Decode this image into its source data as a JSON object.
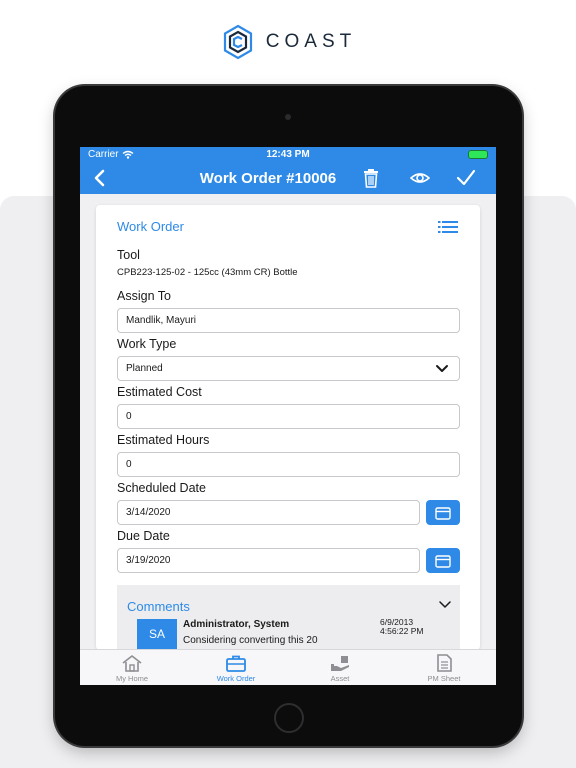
{
  "brand": {
    "name": "COAST"
  },
  "status_bar": {
    "carrier": "Carrier",
    "time": "12:43 PM"
  },
  "nav": {
    "title": "Work Order #10006"
  },
  "form": {
    "section_title": "Work Order",
    "tool": {
      "label": "Tool",
      "value": "CPB223-125-02 - 125cc (43mm CR) Bottle"
    },
    "assign_to": {
      "label": "Assign To",
      "value": "Mandlik, Mayuri"
    },
    "work_type": {
      "label": "Work Type",
      "value": "Planned"
    },
    "estimated_cost": {
      "label": "Estimated Cost",
      "value": "0"
    },
    "estimated_hours": {
      "label": "Estimated Hours",
      "value": "0"
    },
    "scheduled_date": {
      "label": "Scheduled Date",
      "value": "3/14/2020"
    },
    "due_date": {
      "label": "Due Date",
      "value": "3/19/2020"
    }
  },
  "comments": {
    "title": "Comments",
    "items": [
      {
        "initials": "SA",
        "author": "Administrator, System",
        "text": "Considering converting this 20",
        "date": "6/9/2013",
        "time": "4:56:22 PM"
      }
    ]
  },
  "tabs": [
    {
      "label": "My Home",
      "icon": "home-icon",
      "active": false
    },
    {
      "label": "Work Order",
      "icon": "briefcase-icon",
      "active": true
    },
    {
      "label": "Asset",
      "icon": "asset-hand-icon",
      "active": false
    },
    {
      "label": "PM Sheet",
      "icon": "pm-sheet-icon",
      "active": false
    }
  ],
  "colors": {
    "accent": "#2e8ae6",
    "battery": "#2ee65a",
    "panel": "#efeff1"
  }
}
